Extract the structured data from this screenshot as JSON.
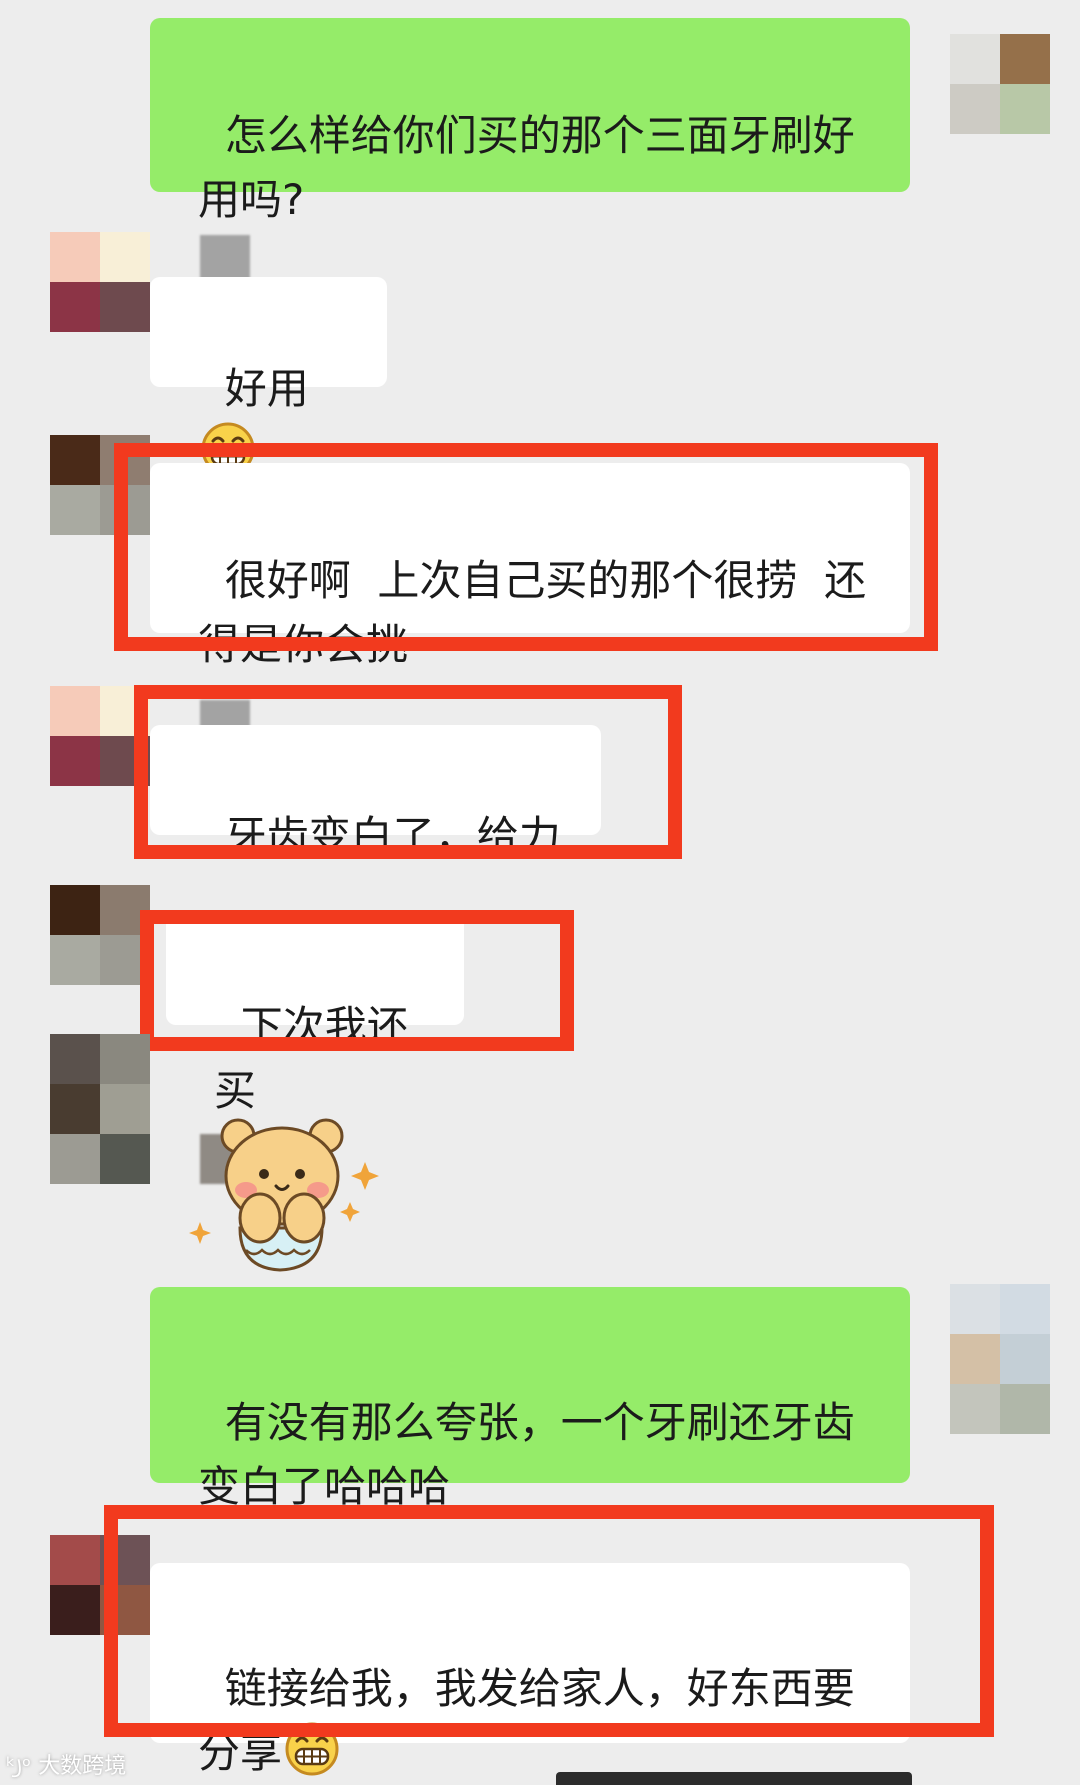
{
  "messages": [
    {
      "id": "m1",
      "text": "怎么样给你们买的那个三面牙刷好用吗?"
    },
    {
      "id": "m2",
      "text": "好用"
    },
    {
      "id": "m3",
      "text": "很好啊  上次自己买的那个很捞  还得是你会挑"
    },
    {
      "id": "m4",
      "text": "牙齿变白了，给力"
    },
    {
      "id": "m5",
      "text": "下次我还买"
    },
    {
      "id": "m6",
      "sticker": "bear-sticker"
    },
    {
      "id": "m7",
      "text": "有没有那么夸张，一个牙刷还牙齿变白了哈哈哈"
    },
    {
      "id": "m8",
      "text": "链接给我，我发给家人，好东西要分享"
    }
  ],
  "emoji_name": "grin-emoji",
  "sticker_name": "bear-sticker",
  "watermark": "大数跨境",
  "colors": {
    "background": "#ededed",
    "my_bubble": "#95ec69",
    "other_bubble": "#ffffff",
    "highlight": "#f23a1e"
  }
}
